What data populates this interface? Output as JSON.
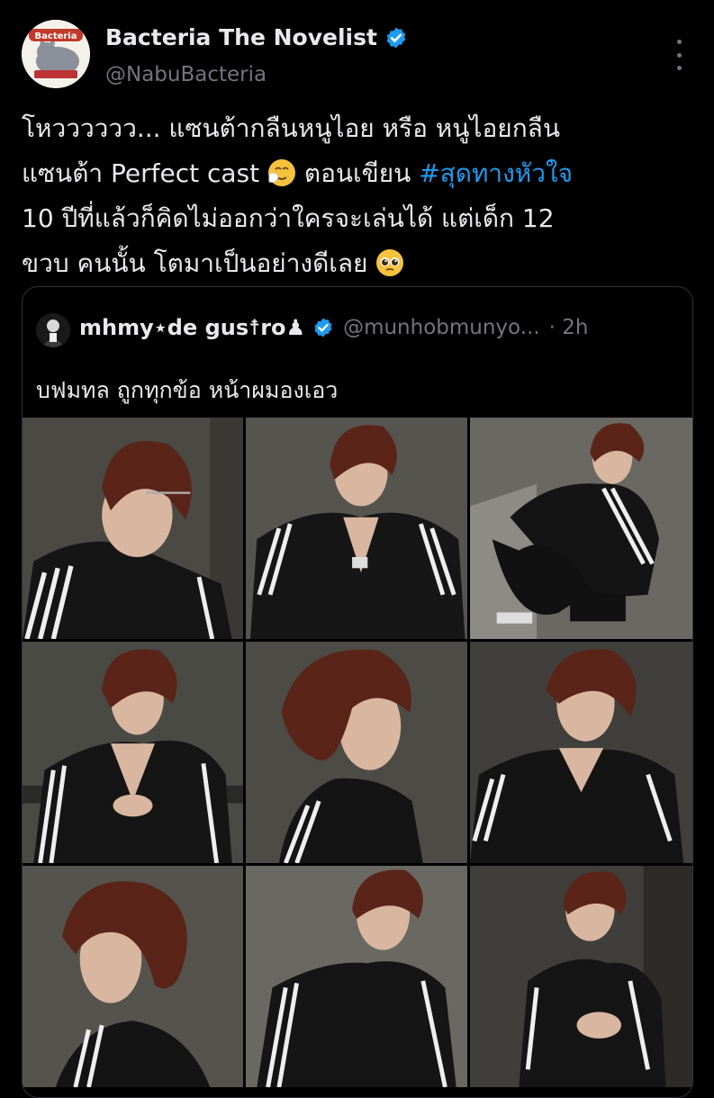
{
  "author": {
    "name": "Bacteria The Novelist",
    "handle": "@NabuBacteria",
    "avatar_text": "Bacteria"
  },
  "tweet": {
    "line1": "โหวววววว... แซนต้ากลืนหนูไอย หรือ หนูไอยกลืน",
    "line2_a": "แซนต้า Perfect cast",
    "line2_b": " ตอนเขียน ",
    "hashtag": "#สุดทางหัวใจ",
    "line3": "10 ปีที่แล้วก็คิดไม่ออกว่าใครจะเล่นได้ แต่เด็ก 12",
    "line4": "ขวบ คนนั้น โตมาเป็นอย่างดีเลย"
  },
  "quote": {
    "name": "mhmy⋆de gus☨ro♟",
    "handle": "@munhobmunyo...",
    "time": "· 2h",
    "text": "บฟมทล ถูกทุกข้อ หน้าผมองเอว"
  },
  "colors": {
    "background": "#000000",
    "text": "#e7e9ea",
    "secondary": "#71767b",
    "accent": "#1d9bf0",
    "border": "#2f3336"
  },
  "icons": {
    "verified": "verified-badge-icon",
    "more": "more-options-icon",
    "emoji1": "sneezing-face-emoji",
    "emoji2": "pleading-face-emoji"
  }
}
